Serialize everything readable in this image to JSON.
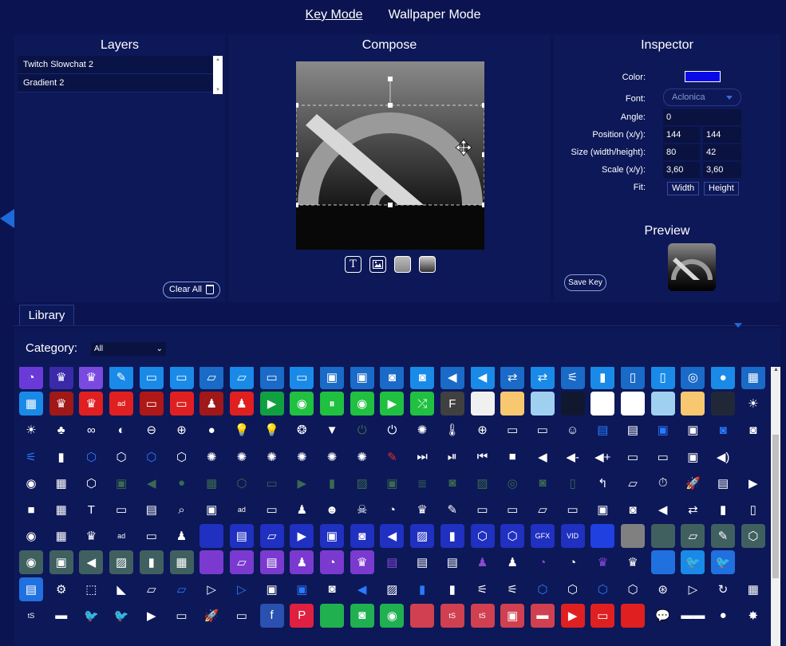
{
  "nav": {
    "key_mode": "Key Mode",
    "wallpaper_mode": "Wallpaper Mode"
  },
  "layers": {
    "title": "Layers",
    "items": [
      "Twitch Slowchat 2",
      "Gradient 2"
    ],
    "clear_all": "Clear All"
  },
  "compose": {
    "title": "Compose"
  },
  "inspector": {
    "title": "Inspector",
    "color_label": "Color:",
    "color_value": "#0a0ae6",
    "font_label": "Font:",
    "font_value": "Aclonica",
    "angle_label": "Angle:",
    "angle_value": "0",
    "position_label": "Position (x/y):",
    "position_x": "144",
    "position_y": "144",
    "size_label": "Size (width/height):",
    "size_w": "80",
    "size_h": "42",
    "scale_label": "Scale (x/y):",
    "scale_x": "3,60",
    "scale_y": "3,60",
    "fit_label": "Fit:",
    "fit_width": "Width",
    "fit_height": "Height",
    "preview_title": "Preview",
    "save_key": "Save Key"
  },
  "library": {
    "tab": "Library",
    "category_label": "Category:",
    "category_value": "All"
  },
  "icon_rows": [
    [
      "#6a3ad8:speedometer",
      "#3a2aa8:crown",
      "#7a4ae0:crown",
      "#1a8ae8:edit",
      "#1a8ae8:chat",
      "#1a8ae8:chat",
      "#1a6ac8:folder",
      "#1a8ae8:folder",
      "#1a6ac8:chat",
      "#1a8ae8:chat",
      "#1a6ac8:bag",
      "#1a6ac8:bag",
      "#1a6ac8:camera",
      "#1a8ae8:camera",
      "#1a6ac8:volume",
      "#1a8ae8:volume",
      "#1a6ac8:switch",
      "#1a8ae8:switch",
      "#1a6ac8:mic-off",
      "#1a8ae8:mic",
      "#1a6ac8:remote",
      "#1a8ae8:remote",
      "#1a6ac8:ring",
      "#1a8ae8:circle",
      "#1a6ac8:clapper"
    ],
    [
      "#1a8ae8:clapper",
      "#a01818:crown",
      "#e02020:crown",
      "#e02020:ad",
      "#b01818:chat",
      "#e02020:chat",
      "#a01818:person",
      "#e02020:person",
      "#10a040:play",
      "#20c040:target",
      "#20c040:pause",
      "#20c040:target",
      "#20c040:play",
      "#20c040:shuffle",
      "#404040:follow",
      "#f0f0f0:blank",
      "#f8c870:blank",
      "#a0d0f0:blank",
      "#101830:blank",
      "#ffffff:blank",
      "#ffffff:blank",
      "#a0d0f0:blank",
      "#f8c870:blank",
      "#202838:blank",
      "none:sun"
    ],
    [
      "none:sun",
      "none:circles3",
      "none:circles3o",
      "none:halfcircle",
      "none:minus",
      "none:plus",
      "none:rgb",
      "none:bulb",
      "none:bulb",
      "none:bulbs",
      "none:bulbcolor",
      "none:power-dim",
      "none:power",
      "none:sun-sm",
      "none:thermo",
      "none:globe",
      "none:battery",
      "none:battery",
      "none:controller",
      "none:twitch-blue",
      "none:twitch",
      "none:bag-blue",
      "none:bag",
      "none:camera-blue",
      "none:camera"
    ],
    [
      "none:mic-off-blue",
      "none:mic",
      "none:hex-blue",
      "none:hex",
      "none:hex-blue",
      "none:hex",
      "none:sun-sm",
      "none:sun-sm",
      "none:sun-sm",
      "none:sun-sm",
      "none:sun-sm",
      "none:sun-sm",
      "none:edit-red",
      "none:skip",
      "none:playpause",
      "none:prev",
      "none:stop",
      "none:vol",
      "none:vol-minus",
      "none:vol-plus",
      "none:chat",
      "none:chat",
      "none:bag",
      "none:vol-wave"
    ],
    [
      "none:record",
      "none:clapper",
      "none:hex",
      "none:bag-dim",
      "none:vol-dim",
      "none:circle-dim",
      "none:clapper-dim",
      "none:hex-dim",
      "none:chat-dim",
      "none:play-dim",
      "none:mic-dim",
      "none:image-dim",
      "none:bag-dim",
      "none:list-dim",
      "none:camera-dim",
      "none:image-dim",
      "none:ring-dim",
      "none:camera-dim",
      "none:remote-dim",
      "none:up-arrow",
      "none:folder",
      "none:timer",
      "none:rocket",
      "none:film",
      "none:playbox"
    ],
    [
      "none:stopbox",
      "none:calc",
      "none:text",
      "none:battery",
      "none:film",
      "none:zoom",
      "none:browser",
      "none:ad",
      "none:chat",
      "none:person",
      "none:discord",
      "none:skull",
      "none:speedometer",
      "none:crown",
      "none:edit",
      "none:chat",
      "none:chat",
      "none:folder",
      "none:chat",
      "none:bag",
      "none:camera",
      "none:vol",
      "none:switch",
      "none:mic",
      "none:remote"
    ],
    [
      "none:record",
      "none:clapper",
      "none:crown",
      "none:ad",
      "none:chat",
      "none:person",
      "#2030c0:blank",
      "#2030c0:twitch",
      "#2030c0:folder",
      "#2030c0:play",
      "#2030c0:bag",
      "#2030c0:camera",
      "#2030c0:vol",
      "#2030c0:image",
      "#2030c0:mic",
      "#2030c0:hex",
      "#2030c0:hex",
      "#2030c0:gfx",
      "#2030c0:vid",
      "#2040e0:blank",
      "#808080:blank",
      "#406060:blank",
      "#406060:folder",
      "#406060:edit",
      "#406060:hex"
    ],
    [
      "#406060:record",
      "#406060:bag",
      "#406060:vol",
      "#406060:image",
      "#406060:mic",
      "#406060:clapper",
      "#7a3ad0:blank",
      "#7a3ad0:folder",
      "#7a3ad0:twitch",
      "#7a3ad0:person",
      "#7a3ad0:speedometer",
      "#7a3ad0:crown",
      "none:twitch-purple",
      "none:twitch",
      "none:twitch-gray",
      "none:person-purple",
      "none:person",
      "none:speedometer-purple",
      "none:speedometer",
      "none:crown-purple",
      "none:crown",
      "#2070e0:blank",
      "#1a8ae8:twitter",
      "#2070e0:twitter"
    ],
    [
      "#2070e0:twitch",
      "none:gear",
      "none:dashed",
      "none:streamlabs",
      "none:folder",
      "none:folder-blue",
      "none:play-o",
      "none:play-blue",
      "none:bag",
      "none:bag-blue",
      "none:camera",
      "none:vol-blue",
      "none:image",
      "none:mic-blue",
      "none:mic",
      "none:mic-off",
      "none:mic-off",
      "none:hex-blue",
      "none:hex",
      "none:hex-blue",
      "none:hex",
      "none:obs",
      "none:play-o",
      "none:refresh",
      "none:clapper"
    ],
    [
      "none:ts",
      "none:monitor",
      "none:twitter",
      "none:twitter",
      "none:youtube",
      "none:chat",
      "none:rocket",
      "none:battery",
      "#2a50b0:facebook",
      "#e02040:pinterest",
      "#20b050:blank",
      "#20b050:camera",
      "#20b050:spotify",
      "#d04050:blank",
      "#d04050:ts",
      "#d04050:ts",
      "#d04050:bag",
      "#d04050:monitor",
      "#e02020:youtube",
      "#e02020:chat",
      "#e02020:blank",
      "none:speech",
      "none:glasses",
      "none:bomb",
      "none:comic"
    ]
  ]
}
